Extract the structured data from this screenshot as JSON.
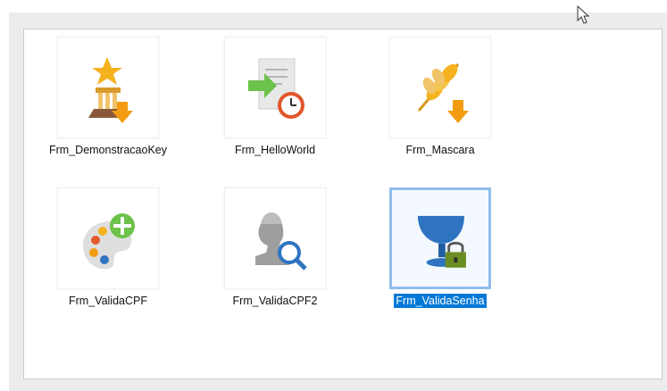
{
  "files": [
    {
      "name": "Frm_DemonstracaoKey",
      "icon": "trophy-pedestal-download-icon",
      "selected": false
    },
    {
      "name": "Frm_HelloWorld",
      "icon": "document-clock-icon",
      "selected": false
    },
    {
      "name": "Frm_Mascara",
      "icon": "wheat-download-icon",
      "selected": false
    },
    {
      "name": "Frm_ValidaCPF",
      "icon": "palette-plus-icon",
      "selected": false
    },
    {
      "name": "Frm_ValidaCPF2",
      "icon": "bust-magnifier-icon",
      "selected": false
    },
    {
      "name": "Frm_ValidaSenha",
      "icon": "goblet-lock-icon",
      "selected": true
    }
  ],
  "colors": {
    "selection_bg": "#0078d7",
    "selection_border": "#8fbde8",
    "orange": "#f5a623",
    "green": "#5cb85c",
    "blue": "#2f74c0"
  }
}
